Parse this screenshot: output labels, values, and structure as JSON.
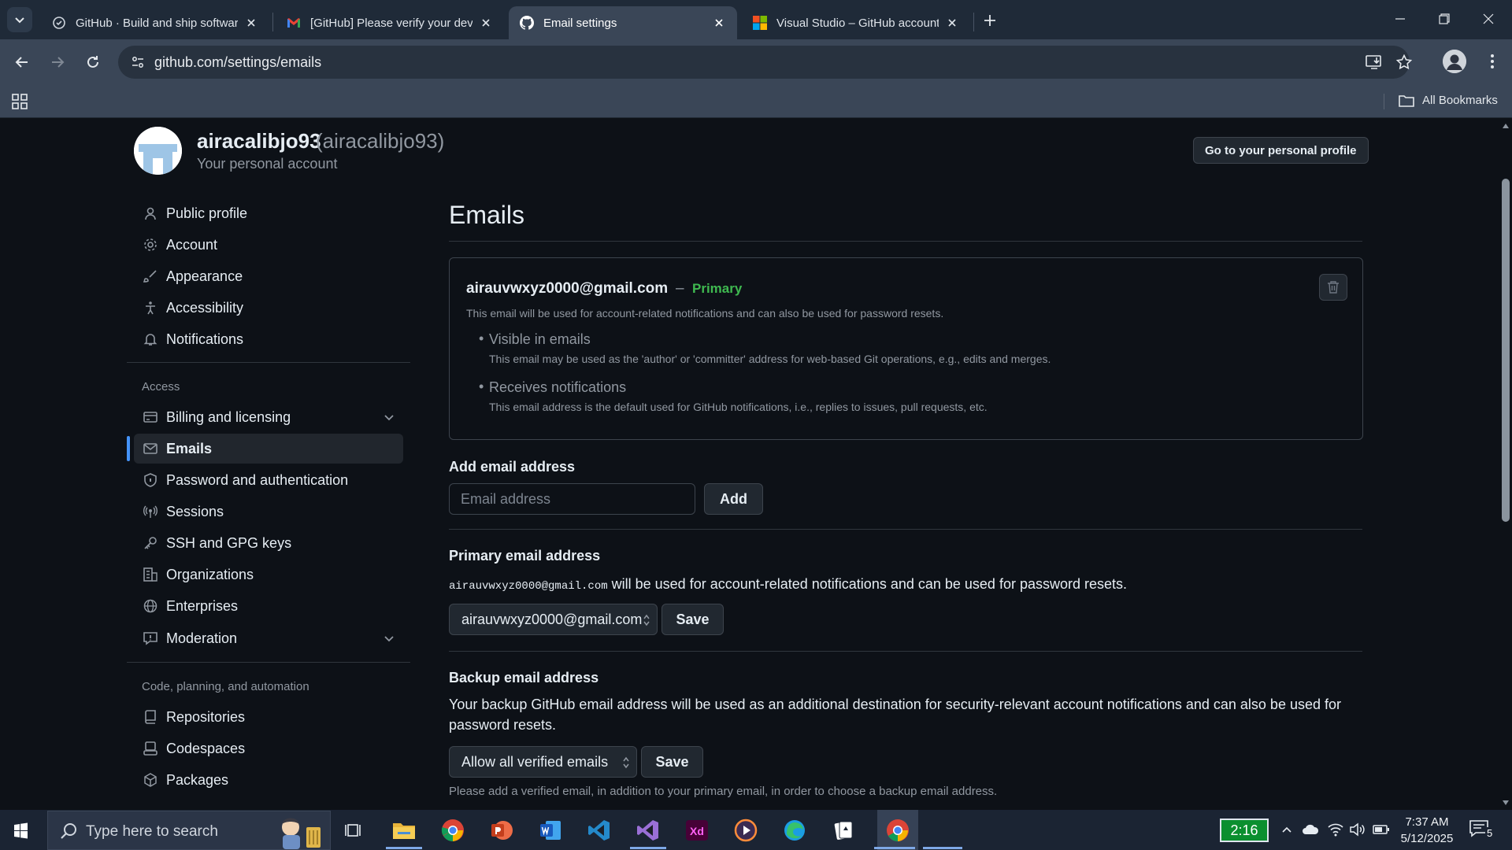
{
  "browser": {
    "tabs": [
      {
        "title": "GitHub · Build and ship software",
        "icon": "github-favicon-icon"
      },
      {
        "title": "[GitHub] Please verify your device",
        "icon": "gmail-icon"
      },
      {
        "title": "Email settings",
        "icon": "github-icon"
      },
      {
        "title": "Visual Studio – GitHub account",
        "icon": "microsoft-icon"
      }
    ],
    "url": "github.com/settings/emails",
    "bookmarks_label": "All Bookmarks"
  },
  "header": {
    "username": "airacalibjo93",
    "handle": "(airacalibjo93)",
    "subtitle": "Your personal account",
    "profile_button": "Go to your personal profile"
  },
  "sidebar": {
    "group1": [
      {
        "label": "Public profile",
        "icon": "person-icon"
      },
      {
        "label": "Account",
        "icon": "gear-icon"
      },
      {
        "label": "Appearance",
        "icon": "paintbrush-icon"
      },
      {
        "label": "Accessibility",
        "icon": "accessibility-icon"
      },
      {
        "label": "Notifications",
        "icon": "bell-icon"
      }
    ],
    "access_heading": "Access",
    "access": [
      {
        "label": "Billing and licensing",
        "icon": "credit-card-icon"
      },
      {
        "label": "Emails",
        "icon": "mail-icon"
      },
      {
        "label": "Password and authentication",
        "icon": "shield-lock-icon"
      },
      {
        "label": "Sessions",
        "icon": "broadcast-icon"
      },
      {
        "label": "SSH and GPG keys",
        "icon": "key-icon"
      },
      {
        "label": "Organizations",
        "icon": "organization-icon"
      },
      {
        "label": "Enterprises",
        "icon": "globe-icon"
      },
      {
        "label": "Moderation",
        "icon": "report-icon"
      }
    ],
    "code_heading": "Code, planning, and automation",
    "code": [
      {
        "label": "Repositories",
        "icon": "repo-icon"
      },
      {
        "label": "Codespaces",
        "icon": "codespaces-icon"
      },
      {
        "label": "Packages",
        "icon": "package-icon"
      }
    ]
  },
  "main": {
    "title": "Emails",
    "email": {
      "address": "airauvwxyz0000@gmail.com",
      "dash": "–",
      "badge": "Primary",
      "description": "This email will be used for account-related notifications and can also be used for password resets.",
      "bullets": [
        {
          "title": "Visible in emails",
          "desc": "This email may be used as the 'author' or 'committer' address for web-based Git operations, e.g., edits and merges."
        },
        {
          "title": "Receives notifications",
          "desc": "This email address is the default used for GitHub notifications, i.e., replies to issues, pull requests, etc."
        }
      ]
    },
    "add_email": {
      "title": "Add email address",
      "placeholder": "Email address",
      "button": "Add"
    },
    "primary_email": {
      "title": "Primary email address",
      "address_mono": "airauvwxyz0000@gmail.com",
      "text": " will be used for account-related notifications and can be used for password resets.",
      "selected": "airauvwxyz0000@gmail.com",
      "button": "Save"
    },
    "backup_email": {
      "title": "Backup email address",
      "text": "Your backup GitHub email address will be used as an additional destination for security-relevant account notifications and can also be used for password resets.",
      "selected": "Allow all verified emails",
      "button": "Save",
      "note": "Please add a verified email, in addition to your primary email, in order to choose a backup email address."
    }
  },
  "taskbar": {
    "search_placeholder": "Type here to search",
    "timer": "2:16",
    "time": "7:37 AM",
    "date": "5/12/2025",
    "notification_count": "5"
  },
  "colors": {
    "accent": "#4493f8",
    "primary_badge": "#3fb950",
    "page_bg": "#0d1117"
  }
}
